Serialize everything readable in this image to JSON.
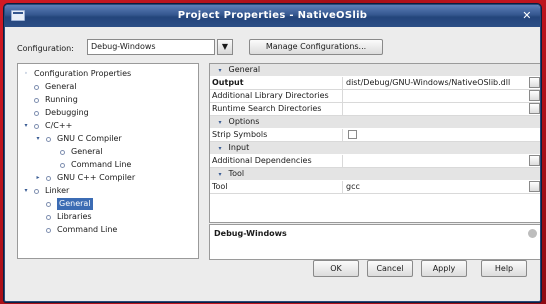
{
  "window": {
    "title": "Project Properties - NativeOSlib"
  },
  "config": {
    "label": "Configuration:",
    "selected": "Debug-Windows",
    "manage_label": "Manage Configurations..."
  },
  "tree": {
    "items": [
      {
        "label": "Configuration Properties"
      },
      {
        "label": "General"
      },
      {
        "label": "Running"
      },
      {
        "label": "Debugging"
      },
      {
        "label": "C/C++"
      },
      {
        "label": "GNU C Compiler"
      },
      {
        "label": "General"
      },
      {
        "label": "Command Line"
      },
      {
        "label": "GNU C++ Compiler"
      },
      {
        "label": "Linker"
      },
      {
        "label": "General"
      },
      {
        "label": "Libraries"
      },
      {
        "label": "Command Line"
      }
    ],
    "selected_index": 10
  },
  "properties": {
    "categories": [
      {
        "label": "General"
      },
      {
        "label": "Options"
      },
      {
        "label": "Input"
      },
      {
        "label": "Tool"
      }
    ],
    "rows": [
      {
        "name": "Output",
        "value": "dist/Debug/GNU-Windows/NativeOSlib.dll"
      },
      {
        "name": "Additional Library Directories",
        "value": ""
      },
      {
        "name": "Runtime Search Directories",
        "value": ""
      },
      {
        "name": "Strip Symbols",
        "value": ""
      },
      {
        "name": "Additional Dependencies",
        "value": ""
      },
      {
        "name": "Tool",
        "value": "gcc"
      }
    ]
  },
  "description": {
    "title": "Debug-Windows"
  },
  "buttons": {
    "ok": "OK",
    "cancel": "Cancel",
    "apply": "Apply",
    "help": "Help"
  }
}
